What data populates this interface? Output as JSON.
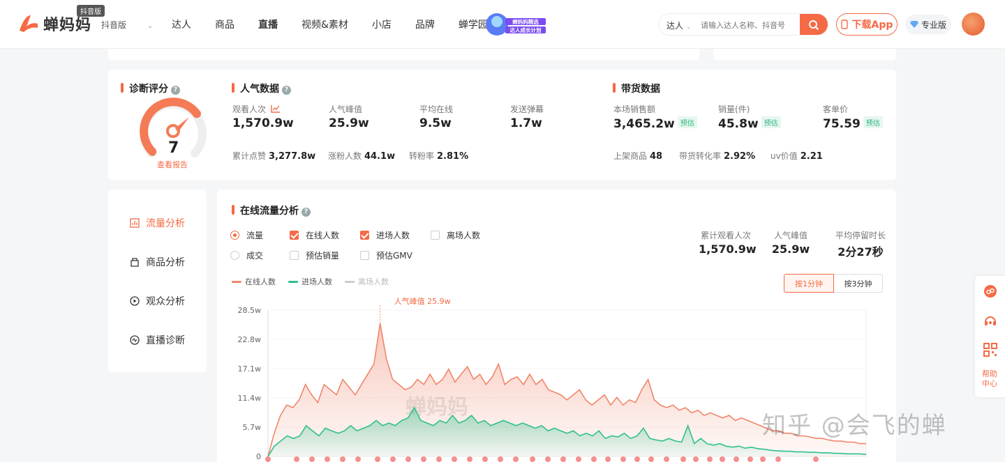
{
  "header": {
    "logo_text": "蝉妈妈",
    "logo_badge": "抖音版",
    "platform": "抖音版",
    "nav": [
      "达人",
      "商品",
      "直播",
      "视频&素材",
      "小店",
      "品牌",
      "蝉学园"
    ],
    "nav_active": "直播",
    "promo_line1": "蝉妈妈精选",
    "promo_line2": "达人成长计划",
    "search_type": "达人",
    "search_placeholder": "请输入达人名称、抖音号",
    "download_label": "下载App",
    "pro_label": "专业版"
  },
  "diagnosis": {
    "title": "诊断评分",
    "score": "7",
    "report_link": "查看报告",
    "gauge_fraction": 0.7
  },
  "popularity": {
    "title": "人气数据",
    "metrics": [
      {
        "label": "观看人次",
        "value": "1,570.9w"
      },
      {
        "label": "人气峰值",
        "value": "25.9w"
      },
      {
        "label": "平均在线",
        "value": "9.5w"
      },
      {
        "label": "发送弹幕",
        "value": "1.7w"
      }
    ],
    "small": [
      {
        "label": "累计点赞",
        "value": "3,277.8w"
      },
      {
        "label": "涨粉人数",
        "value": "44.1w"
      },
      {
        "label": "转粉率",
        "value": "2.81%"
      }
    ]
  },
  "sales": {
    "title": "带货数据",
    "est_label": "预估",
    "metrics": [
      {
        "label": "本场销售额",
        "value": "3,465.2w"
      },
      {
        "label": "销量(件)",
        "value": "45.8w"
      },
      {
        "label": "客单价",
        "value": "75.59"
      }
    ],
    "small": [
      {
        "label": "上架商品",
        "value": "48"
      },
      {
        "label": "带货转化率",
        "value": "2.92%"
      },
      {
        "label": "uv价值",
        "value": "2.21"
      }
    ]
  },
  "sidebar": {
    "items": [
      {
        "label": "流量分析",
        "active": true
      },
      {
        "label": "商品分析",
        "active": false
      },
      {
        "label": "观众分析",
        "active": false
      },
      {
        "label": "直播诊断",
        "active": false
      }
    ]
  },
  "traffic": {
    "title": "在线流量分析",
    "options_row1": [
      {
        "label": "流量",
        "kind": "radio",
        "checked": true
      },
      {
        "label": "在线人数",
        "kind": "check",
        "checked": true
      },
      {
        "label": "进场人数",
        "kind": "check",
        "checked": true
      },
      {
        "label": "离场人数",
        "kind": "check",
        "checked": false
      }
    ],
    "options_row2": [
      {
        "label": "成交",
        "kind": "radio",
        "checked": false
      },
      {
        "label": "预估销量",
        "kind": "check",
        "checked": false
      },
      {
        "label": "预估GMV",
        "kind": "check",
        "checked": false
      }
    ],
    "stats": [
      {
        "label": "累计观看人次",
        "value": "1,570.9w"
      },
      {
        "label": "人气峰值",
        "value": "25.9w"
      },
      {
        "label": "平均停留时长",
        "value": "2分27秒"
      }
    ],
    "toggle": [
      "按1分钟",
      "按3分钟"
    ],
    "toggle_active": 0,
    "chart_watermark": "蝉妈妈"
  },
  "chart_data": {
    "type": "area",
    "title": "",
    "xlabel": "",
    "ylabel": "",
    "ylim": [
      0,
      28.5
    ],
    "y_ticks": [
      "0",
      "5.7w",
      "11.4w",
      "17.1w",
      "22.8w",
      "28.5w"
    ],
    "legend": [
      "在线人数",
      "进场人数",
      "离场人数"
    ],
    "annotation": "人气峰值 25.9w",
    "series": [
      {
        "name": "在线人数",
        "color": "#f0866b",
        "values": [
          0,
          4.5,
          8,
          10,
          9.5,
          11,
          14,
          12,
          10.5,
          14,
          13,
          12,
          15,
          13.5,
          12,
          14,
          16,
          18,
          25.9,
          19,
          15,
          14,
          13,
          13.5,
          15,
          14,
          16,
          14,
          15,
          17,
          14.5,
          16,
          17.5,
          15,
          16,
          14,
          15.5,
          18,
          14,
          15,
          15.5,
          14,
          16,
          14,
          15,
          13,
          12.5,
          12,
          11,
          12,
          13,
          11,
          10,
          11,
          12,
          10,
          11.5,
          10,
          11,
          10.5,
          13,
          15,
          11,
          10,
          9.5,
          10,
          9,
          9.5,
          8.5,
          9,
          8,
          8.5,
          8,
          7.5,
          8,
          7,
          7.5,
          7,
          6.5,
          6,
          5.5,
          5,
          5,
          4.5,
          4.5,
          4,
          4,
          3.8,
          3.5,
          3.5,
          3.2,
          3,
          3,
          2.8,
          2.8,
          2.5,
          2.5
        ]
      },
      {
        "name": "进场人数",
        "color": "#2fc08c",
        "values": [
          0,
          2,
          3,
          4,
          3.5,
          4,
          6,
          5,
          4,
          5.5,
          5,
          4.5,
          5,
          6,
          5,
          5.5,
          6,
          7,
          6,
          6.5,
          6,
          7,
          7.5,
          9.5,
          7,
          6.5,
          6,
          7,
          6.5,
          8,
          6.5,
          7,
          8,
          6.5,
          7,
          6,
          6.5,
          7,
          6.5,
          6,
          6.5,
          6,
          5.5,
          6,
          5,
          5.5,
          5,
          4.5,
          5,
          4,
          4.5,
          4,
          5,
          3.5,
          4,
          3.8,
          4.5,
          3.5,
          4,
          5.5,
          3.5,
          3.2,
          3,
          3.5,
          3,
          2.8,
          6,
          2.5,
          3.5,
          2.5,
          2.2,
          2.5,
          2,
          1.8,
          2,
          1.6,
          1.8,
          1.5,
          1.4,
          1.2,
          1.1,
          1,
          1,
          0.9,
          0.9,
          0.8,
          0.8,
          0.7,
          0.7,
          0.6,
          0.6,
          0.5,
          0.5,
          0.5,
          0.4
        ]
      }
    ]
  },
  "floatbar": {
    "help_label": "帮助中心"
  },
  "watermark": "知乎 @会飞的蝉"
}
